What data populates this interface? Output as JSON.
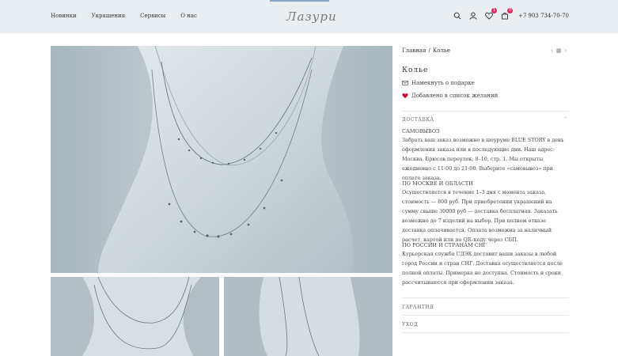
{
  "header": {
    "nav": [
      "Новинки",
      "Украшения",
      "Сервисы",
      "О нас"
    ],
    "logo_text": "Лазури",
    "phone": "+7 903 734-70-70",
    "wishlist_count": "1",
    "cart_count": "0"
  },
  "breadcrumbs": {
    "home": "Главная",
    "sep": "/",
    "current": "Колье"
  },
  "product": {
    "title": "Колье",
    "actions": {
      "hint_gift": "Намекнуть о подарке",
      "wishlist_added": "Добавлено в список желаний"
    }
  },
  "accordion": {
    "delivery": {
      "heading": "ДОСТАВКА",
      "pickup_title": "САМОВЫВОЗ",
      "pickup_text": "Забрать ваш заказ возможно в шоуруме BLUE STORY в день оформления заказа или в последующие дни. Наш адрес: Москва, Брюсов переулок, 8–10, стр. 1. Мы открыты ежедневно с 11:00 до 21:00. Выберите «самовывоз» при оплате заказа.",
      "moscow_title": "ПО МОСКВЕ И ОБЛАСТИ",
      "moscow_text": "Осуществляется в течение 1–3 дня с момента заказа, стоимость — 800 руб. При приобретении украшений на сумму свыше 30000 руб — доставка бесплатная. Заказать возможно до 7 изделий на выбор. При полном отказе доставка оплачивается. Оплата возможна за наличный расчет, картой или по QR–коду через СБП.",
      "russia_title": "ПО РОССИИ И СТРАНАМ СНГ",
      "russia_text": "Курьерская служба СДЭК доставит ваши заказы в любой город России и стран СНГ. Доставка осуществляется после полной оплаты. Примерка не доступна. Стоимость и сроки рассчитываются при оформлении заказа."
    },
    "guarantee": {
      "heading": "ГАРАНТИЯ"
    },
    "care": {
      "heading": "УХОД"
    }
  },
  "colors": {
    "header_bg": "#e9eef2",
    "badge": "#e0285c",
    "heart": "#c8102e"
  }
}
